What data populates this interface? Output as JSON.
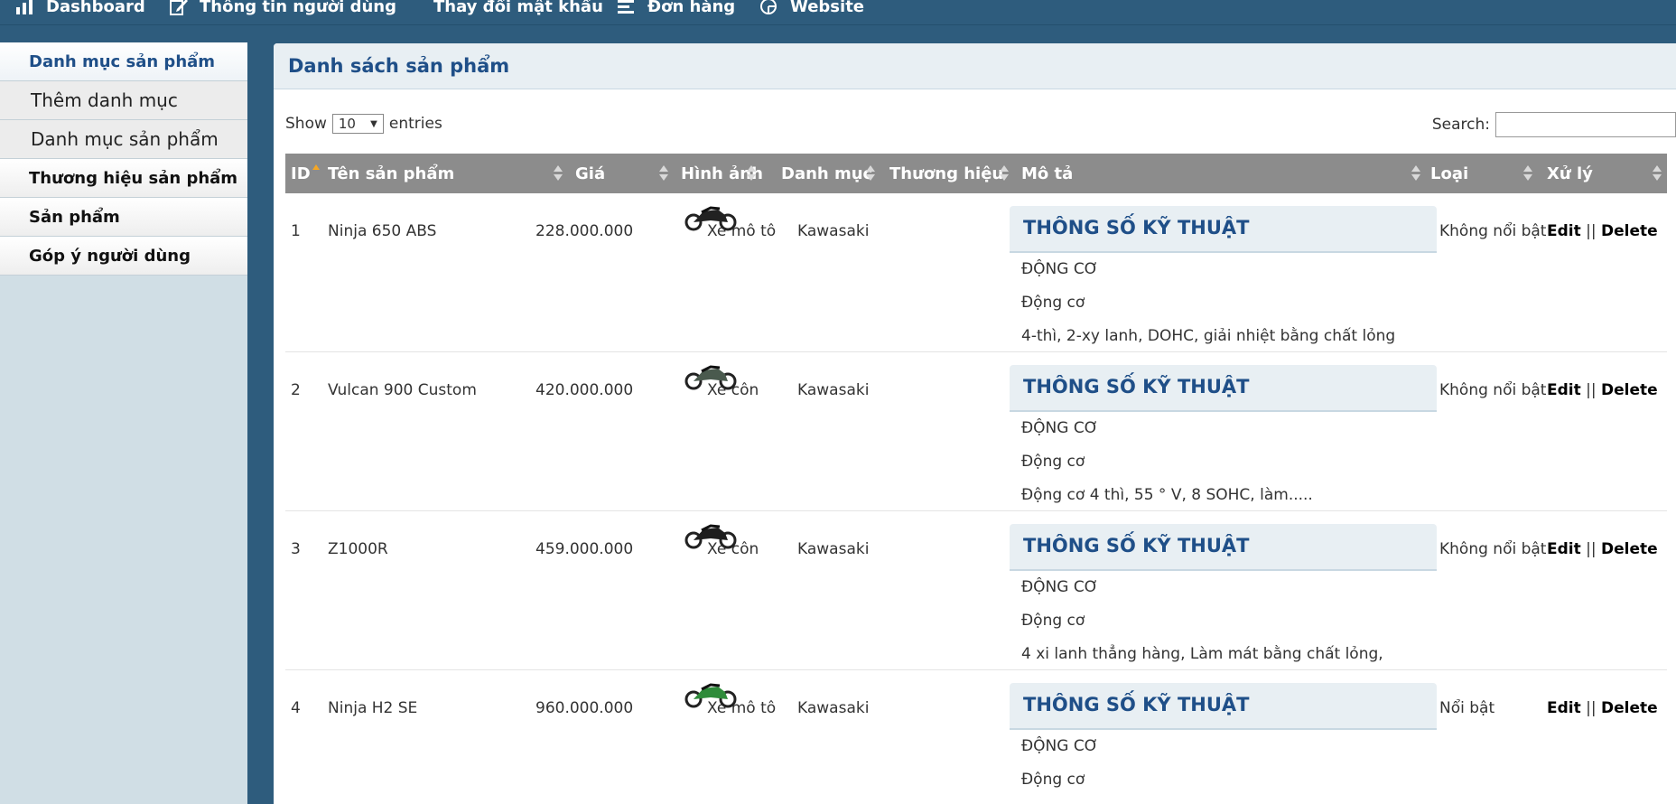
{
  "nav": {
    "dashboard": "Dashboard",
    "user_info": "Thông tin người dùng",
    "change_password": "Thay đổi mật khẩu",
    "orders": "Đơn hàng",
    "website": "Website"
  },
  "sidebar": {
    "items": [
      {
        "label": "Danh mục sản phẩm"
      },
      {
        "label": "Thêm danh mục"
      },
      {
        "label": "Danh mục sản phẩm"
      },
      {
        "label": "Thương hiệu sản phẩm"
      },
      {
        "label": "Sản phẩm"
      },
      {
        "label": "Góp ý người dùng"
      }
    ]
  },
  "panel": {
    "title": "Danh sách sản phẩm"
  },
  "controls": {
    "show_label": "Show",
    "entries_value": "10",
    "entries_label": "entries",
    "search_label": "Search:",
    "search_value": ""
  },
  "table": {
    "headers": [
      "ID",
      "Tên sản phẩm",
      "Giá",
      "Hình ảnh",
      "Danh mục",
      "Thương hiệu",
      "Mô tả",
      "Loại",
      "Xử lý"
    ],
    "spec_title": "THÔNG SỐ KỸ THUẬT",
    "edit_label": "Edit",
    "separator": "||",
    "delete_label": "Delete",
    "rows": [
      {
        "id": "1",
        "name": "Ninja 650 ABS",
        "price": "228.000.000",
        "category": "Xe mô tô",
        "brand": "Kawasaki",
        "desc1": "ĐỘNG CƠ",
        "desc2": "Động cơ",
        "desc3": "4-thì, 2-xy lanh, DOHC, giải nhiệt bằng chất lỏng",
        "type": "Không nổi bật",
        "bike_color": "#222222"
      },
      {
        "id": "2",
        "name": "Vulcan 900 Custom",
        "price": "420.000.000",
        "category": "Xe côn",
        "brand": "Kawasaki",
        "desc1": "ĐỘNG CƠ",
        "desc2": "Động cơ",
        "desc3": "Động cơ 4 thì, 55 ° V, 8 SOHC, làm.....",
        "type": "Không nổi bật",
        "bike_color": "#4a5a4e"
      },
      {
        "id": "3",
        "name": "Z1000R",
        "price": "459.000.000",
        "category": "Xe côn",
        "brand": "Kawasaki",
        "desc1": "ĐỘNG CƠ",
        "desc2": "Động cơ",
        "desc3": "4 xi lanh thẳng hàng, Làm mát bằng chất lỏng,",
        "type": "Không nổi bật",
        "bike_color": "#1e1e1e"
      },
      {
        "id": "4",
        "name": "Ninja H2 SE",
        "price": "960.000.000",
        "category": "Xe mô tô",
        "brand": "Kawasaki",
        "desc1": "ĐỘNG CƠ",
        "desc2": "Động cơ",
        "desc3": "",
        "type": "Nổi bật",
        "bike_color": "#2e8b3a"
      }
    ]
  }
}
